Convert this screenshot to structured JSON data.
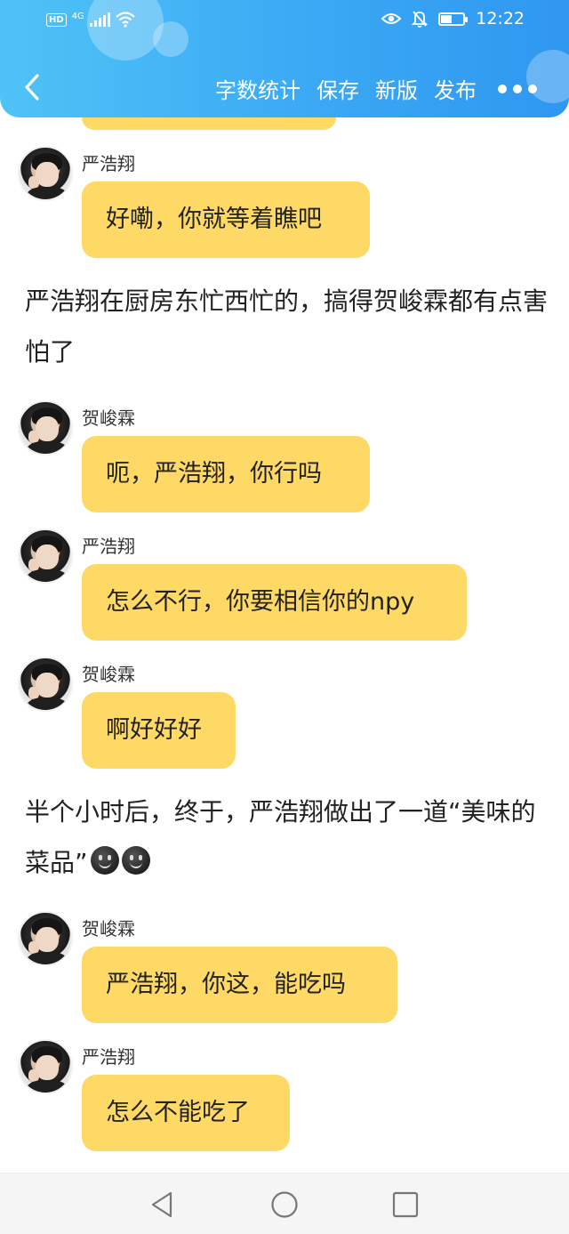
{
  "status_bar": {
    "hd": "HD",
    "network": "4G",
    "time": "12:22",
    "battery_level": 0.45
  },
  "toolbar": {
    "word_count": "字数统计",
    "save": "保存",
    "new_version": "新版",
    "publish": "发布"
  },
  "accent_color": "#ffd966",
  "header_color": "#3ba9f4",
  "messages": [
    {
      "sender": "严浩翔",
      "text": "好嘞，你就等着瞧吧"
    },
    {
      "sender": "贺峻霖",
      "text": "呃，严浩翔，你行吗"
    },
    {
      "sender": "严浩翔",
      "text": "怎么不行，你要相信你的npy"
    },
    {
      "sender": "贺峻霖",
      "text": "啊好好好"
    },
    {
      "sender": "贺峻霖",
      "text": "严浩翔，你这，能吃吗"
    },
    {
      "sender": "严浩翔",
      "text": "怎么不能吃了"
    }
  ],
  "narrations": [
    "严浩翔在厨房东忙西忙的，搞得贺峻霖都有点害怕了",
    "半个小时后，终于，严浩翔做出了一道“美味的菜品”"
  ]
}
